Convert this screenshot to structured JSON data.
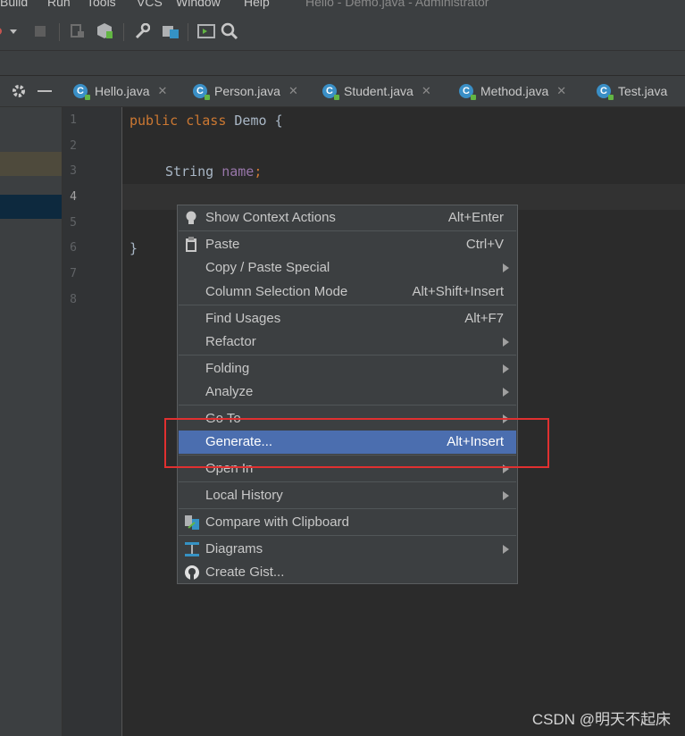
{
  "menubar": {
    "items": [
      "Build",
      "Run",
      "Tools",
      "VCS",
      "Window",
      "Help"
    ],
    "window_title": "Hello - Demo.java - Administrator"
  },
  "toolbar": {
    "icons": [
      "run-config-icon",
      "stop-icon",
      "attach-debugger-icon",
      "build-icon",
      "settings-wrench-icon",
      "project-structure-icon",
      "terminal-icon",
      "search-icon"
    ]
  },
  "tabs": [
    {
      "label": "Hello.java"
    },
    {
      "label": "Person.java"
    },
    {
      "label": "Student.java"
    },
    {
      "label": "Method.java"
    },
    {
      "label": "Test.java"
    }
  ],
  "editor": {
    "line_numbers": [
      "1",
      "2",
      "3",
      "4",
      "5",
      "6",
      "7",
      "8"
    ],
    "code": {
      "l1_kw1": "public",
      "l1_kw2": "class",
      "l1_name": "Demo",
      "l1_brace": "{",
      "l3_type": "String",
      "l3_field": "name",
      "l3_semi": ";",
      "l6_brace": "}"
    }
  },
  "context_menu": {
    "items": [
      {
        "label": "Show Context Actions",
        "shortcut": "Alt+Enter",
        "icon": "lightbulb-icon"
      },
      {
        "label": "Paste",
        "shortcut": "Ctrl+V",
        "icon": "clipboard-icon"
      },
      {
        "label": "Copy / Paste Special",
        "shortcut": ""
      },
      {
        "label": "Column Selection Mode",
        "shortcut": "Alt+Shift+Insert"
      },
      {
        "label": "Find Usages",
        "shortcut": "Alt+F7"
      },
      {
        "label": "Refactor",
        "shortcut": ""
      },
      {
        "label": "Folding",
        "shortcut": ""
      },
      {
        "label": "Analyze",
        "shortcut": ""
      },
      {
        "label": "Go To",
        "shortcut": ""
      },
      {
        "label": "Generate...",
        "shortcut": "Alt+Insert"
      },
      {
        "label": "Open In",
        "shortcut": ""
      },
      {
        "label": "Local History",
        "shortcut": ""
      },
      {
        "label": "Compare with Clipboard",
        "shortcut": "",
        "icon": "compare-icon"
      },
      {
        "label": "Diagrams",
        "shortcut": "",
        "icon": "diagram-icon"
      },
      {
        "label": "Create Gist...",
        "shortcut": "",
        "icon": "github-icon"
      }
    ],
    "highlighted": "Generate...",
    "highlight_color": "#4b6eaf"
  },
  "annotation_color": "#e03030",
  "watermark": "CSDN @明天不起床"
}
